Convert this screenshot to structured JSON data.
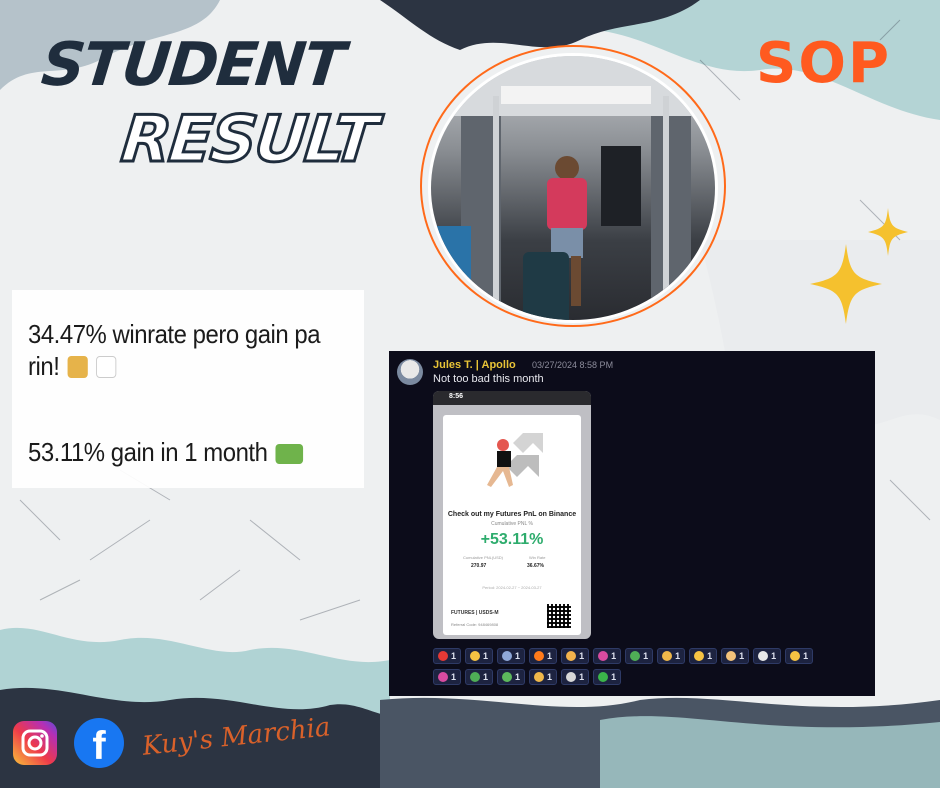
{
  "heading": {
    "line1": "STUDENT",
    "line2": "RESULT"
  },
  "results": {
    "line1": "34.47% winrate pero gain pa rin!",
    "line2": "53.11% gain in 1 month"
  },
  "brand": {
    "logo_text": "SOP",
    "accent_color": "#ff5a1f"
  },
  "chat": {
    "username": "Jules T. | Apollo",
    "timestamp": "03/27/2024 8:58 PM",
    "message": "Not too bad this month",
    "phone": {
      "status_time": "8:56",
      "card_title": "Check out my Futures PnL on Binance",
      "card_subtitle": "Cumulative PNL %",
      "pnl_percent": "+53.11%",
      "label_pnl": "Cumulative PNL(USD)",
      "value_pnl": "270.97",
      "label_winrate": "Win Rate",
      "value_winrate": "36.67%",
      "period": "Period: 2024-02-27 ~ 2024-03-27",
      "footer": "FUTURES | USDS-M",
      "referral": "Referral Code: 948469808"
    },
    "reactions_row1": [
      {
        "icon": "heart",
        "count": "1",
        "color": "#e53935"
      },
      {
        "icon": "thinking-face",
        "count": "1",
        "color": "#f6c343"
      },
      {
        "icon": "rocket",
        "count": "1",
        "color": "#8fa8d8"
      },
      {
        "icon": "fire",
        "count": "1",
        "color": "#ff7a1a"
      },
      {
        "icon": "muscle",
        "count": "1",
        "color": "#f3b34c"
      },
      {
        "icon": "party-popper",
        "count": "1",
        "color": "#d84ba0"
      },
      {
        "icon": "turtle",
        "count": "1",
        "color": "#4fae56"
      },
      {
        "icon": "handshake",
        "count": "1",
        "color": "#f0b84a"
      },
      {
        "icon": "starstruck",
        "count": "1",
        "color": "#f6c343"
      },
      {
        "icon": "thumbs-up",
        "count": "1",
        "color": "#f3c27a"
      },
      {
        "icon": "chart-up",
        "count": "1",
        "color": "#e8e8e8"
      },
      {
        "icon": "money-mouth",
        "count": "1",
        "color": "#f6c343"
      }
    ],
    "reactions_row2": [
      {
        "icon": "confetti",
        "count": "1",
        "color": "#d84ba0"
      },
      {
        "icon": "clover",
        "count": "1",
        "color": "#4fae56"
      },
      {
        "icon": "money-bag-face",
        "count": "1",
        "color": "#5cb85c"
      },
      {
        "icon": "bomb",
        "count": "1",
        "color": "#f0b84a"
      },
      {
        "icon": "skater",
        "count": "1",
        "color": "#d8d8d8"
      },
      {
        "icon": "check",
        "count": "1",
        "color": "#3bb54a"
      }
    ]
  },
  "social": {
    "instagram_icon": "instagram-icon",
    "facebook_icon": "facebook-icon",
    "facebook_glyph": "f",
    "signature": "Kuy's Marchia"
  }
}
